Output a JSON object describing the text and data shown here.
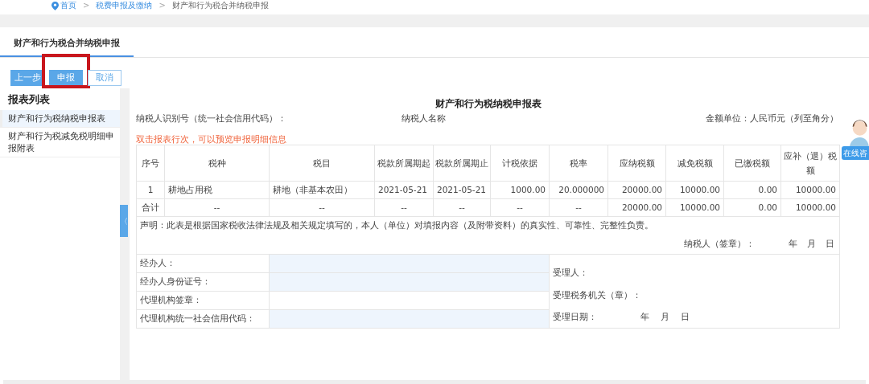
{
  "breadcrumb": [
    "首页",
    "税费申报及缴纳",
    "财产和行为税合并纳税申报"
  ],
  "breadcrumb_separators": [
    ">",
    ">"
  ],
  "tabs": [
    {
      "label": "财产和行为税合并纳税申报",
      "selected": true
    }
  ],
  "buttons": [
    {
      "label": "上一步",
      "kind": "filled",
      "highlighted": false
    },
    {
      "label": "申报",
      "kind": "filled",
      "highlighted": true
    },
    {
      "label": "取消",
      "kind": "outline",
      "highlighted": false
    }
  ],
  "sidebar": {
    "title": "报表列表",
    "items": [
      {
        "label": "财产和行为税纳税申报表",
        "selected": true
      },
      {
        "label": "财产和行为税减免税明细申报附表",
        "selected": false
      }
    ]
  },
  "collapse_handle": "〈",
  "form": {
    "title": "财产和行为税纳税申报表",
    "taxpayer_id_label": "纳税人识别号（统一社会信用代码）：",
    "taxpayer_name_label": "纳税人名称",
    "unit": "金额单位：人民币元（列至角分）",
    "hint": "双击报表行次，可以预览申报明细信息",
    "columns": [
      "序号",
      "税种",
      "税目",
      "税款所属期起",
      "税款所属期止",
      "计税依据",
      "税率",
      "应纳税额",
      "减免税额",
      "已缴税额",
      "应补（退）税额"
    ],
    "rows": [
      [
        "1",
        "耕地占用税",
        "耕地（非基本农田）",
        "2021-05-21",
        "2021-05-21",
        "1000.00",
        "20.000000",
        "20000.00",
        "10000.00",
        "0.00",
        "10000.00"
      ],
      [
        "合计",
        "--",
        "--",
        "--",
        "--",
        "--",
        "--",
        "20000.00",
        "10000.00",
        "0.00",
        "10000.00"
      ]
    ],
    "statement": "声明：此表是根据国家税收法律法规及相关规定填写的，本人（单位）对填报内容（及附带资料）的真实性、可靠性、完整性负责。",
    "signature": {
      "label": "纳税人（签章）：",
      "year": "年",
      "month": "月",
      "day": "日"
    },
    "agent_fields": [
      "经办人：",
      "经办人身份证号：",
      "代理机构签章：",
      "代理机构统一社会信用代码："
    ],
    "receiver_fields": [
      "受理人：",
      "受理税务机关（章）："
    ],
    "receive_date": {
      "label": "受理日期：",
      "year": "年",
      "month": "月",
      "day": "日"
    }
  },
  "chat_button": "在线咨"
}
